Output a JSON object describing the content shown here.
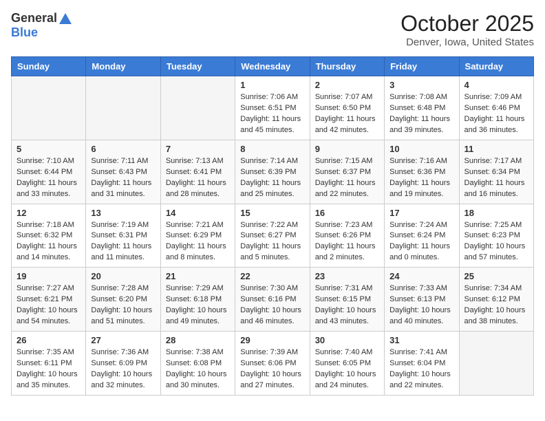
{
  "header": {
    "logo_general": "General",
    "logo_blue": "Blue",
    "month": "October 2025",
    "location": "Denver, Iowa, United States"
  },
  "days_of_week": [
    "Sunday",
    "Monday",
    "Tuesday",
    "Wednesday",
    "Thursday",
    "Friday",
    "Saturday"
  ],
  "weeks": [
    [
      {
        "day": "",
        "info": ""
      },
      {
        "day": "",
        "info": ""
      },
      {
        "day": "",
        "info": ""
      },
      {
        "day": "1",
        "info": "Sunrise: 7:06 AM\nSunset: 6:51 PM\nDaylight: 11 hours\nand 45 minutes."
      },
      {
        "day": "2",
        "info": "Sunrise: 7:07 AM\nSunset: 6:50 PM\nDaylight: 11 hours\nand 42 minutes."
      },
      {
        "day": "3",
        "info": "Sunrise: 7:08 AM\nSunset: 6:48 PM\nDaylight: 11 hours\nand 39 minutes."
      },
      {
        "day": "4",
        "info": "Sunrise: 7:09 AM\nSunset: 6:46 PM\nDaylight: 11 hours\nand 36 minutes."
      }
    ],
    [
      {
        "day": "5",
        "info": "Sunrise: 7:10 AM\nSunset: 6:44 PM\nDaylight: 11 hours\nand 33 minutes."
      },
      {
        "day": "6",
        "info": "Sunrise: 7:11 AM\nSunset: 6:43 PM\nDaylight: 11 hours\nand 31 minutes."
      },
      {
        "day": "7",
        "info": "Sunrise: 7:13 AM\nSunset: 6:41 PM\nDaylight: 11 hours\nand 28 minutes."
      },
      {
        "day": "8",
        "info": "Sunrise: 7:14 AM\nSunset: 6:39 PM\nDaylight: 11 hours\nand 25 minutes."
      },
      {
        "day": "9",
        "info": "Sunrise: 7:15 AM\nSunset: 6:37 PM\nDaylight: 11 hours\nand 22 minutes."
      },
      {
        "day": "10",
        "info": "Sunrise: 7:16 AM\nSunset: 6:36 PM\nDaylight: 11 hours\nand 19 minutes."
      },
      {
        "day": "11",
        "info": "Sunrise: 7:17 AM\nSunset: 6:34 PM\nDaylight: 11 hours\nand 16 minutes."
      }
    ],
    [
      {
        "day": "12",
        "info": "Sunrise: 7:18 AM\nSunset: 6:32 PM\nDaylight: 11 hours\nand 14 minutes."
      },
      {
        "day": "13",
        "info": "Sunrise: 7:19 AM\nSunset: 6:31 PM\nDaylight: 11 hours\nand 11 minutes."
      },
      {
        "day": "14",
        "info": "Sunrise: 7:21 AM\nSunset: 6:29 PM\nDaylight: 11 hours\nand 8 minutes."
      },
      {
        "day": "15",
        "info": "Sunrise: 7:22 AM\nSunset: 6:27 PM\nDaylight: 11 hours\nand 5 minutes."
      },
      {
        "day": "16",
        "info": "Sunrise: 7:23 AM\nSunset: 6:26 PM\nDaylight: 11 hours\nand 2 minutes."
      },
      {
        "day": "17",
        "info": "Sunrise: 7:24 AM\nSunset: 6:24 PM\nDaylight: 11 hours\nand 0 minutes."
      },
      {
        "day": "18",
        "info": "Sunrise: 7:25 AM\nSunset: 6:23 PM\nDaylight: 10 hours\nand 57 minutes."
      }
    ],
    [
      {
        "day": "19",
        "info": "Sunrise: 7:27 AM\nSunset: 6:21 PM\nDaylight: 10 hours\nand 54 minutes."
      },
      {
        "day": "20",
        "info": "Sunrise: 7:28 AM\nSunset: 6:20 PM\nDaylight: 10 hours\nand 51 minutes."
      },
      {
        "day": "21",
        "info": "Sunrise: 7:29 AM\nSunset: 6:18 PM\nDaylight: 10 hours\nand 49 minutes."
      },
      {
        "day": "22",
        "info": "Sunrise: 7:30 AM\nSunset: 6:16 PM\nDaylight: 10 hours\nand 46 minutes."
      },
      {
        "day": "23",
        "info": "Sunrise: 7:31 AM\nSunset: 6:15 PM\nDaylight: 10 hours\nand 43 minutes."
      },
      {
        "day": "24",
        "info": "Sunrise: 7:33 AM\nSunset: 6:13 PM\nDaylight: 10 hours\nand 40 minutes."
      },
      {
        "day": "25",
        "info": "Sunrise: 7:34 AM\nSunset: 6:12 PM\nDaylight: 10 hours\nand 38 minutes."
      }
    ],
    [
      {
        "day": "26",
        "info": "Sunrise: 7:35 AM\nSunset: 6:11 PM\nDaylight: 10 hours\nand 35 minutes."
      },
      {
        "day": "27",
        "info": "Sunrise: 7:36 AM\nSunset: 6:09 PM\nDaylight: 10 hours\nand 32 minutes."
      },
      {
        "day": "28",
        "info": "Sunrise: 7:38 AM\nSunset: 6:08 PM\nDaylight: 10 hours\nand 30 minutes."
      },
      {
        "day": "29",
        "info": "Sunrise: 7:39 AM\nSunset: 6:06 PM\nDaylight: 10 hours\nand 27 minutes."
      },
      {
        "day": "30",
        "info": "Sunrise: 7:40 AM\nSunset: 6:05 PM\nDaylight: 10 hours\nand 24 minutes."
      },
      {
        "day": "31",
        "info": "Sunrise: 7:41 AM\nSunset: 6:04 PM\nDaylight: 10 hours\nand 22 minutes."
      },
      {
        "day": "",
        "info": ""
      }
    ]
  ]
}
